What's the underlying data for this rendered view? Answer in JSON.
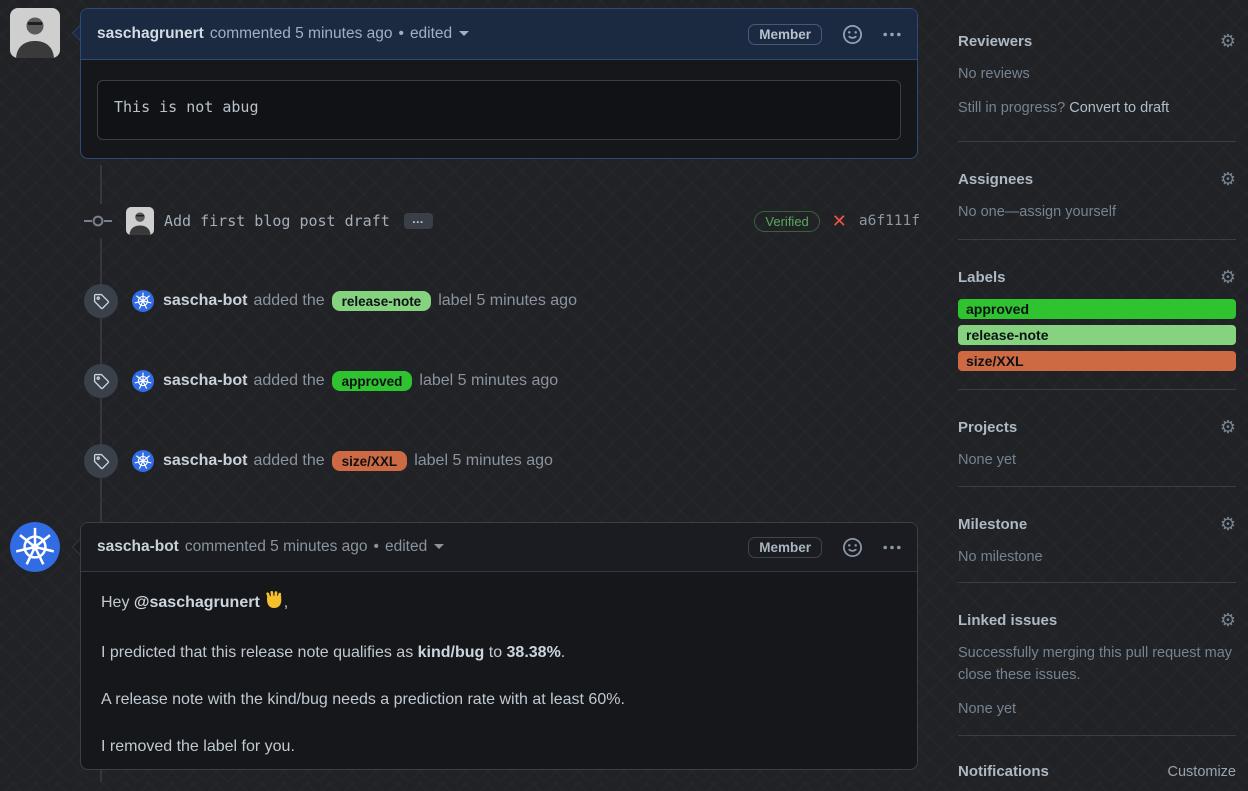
{
  "colors": {
    "highlight_border": "#2d4a75",
    "k8s_blue": "#326ce5",
    "verified_green": "#57ab5c",
    "error_red": "#ee5449",
    "label_approved": "#2fc42f",
    "label_release_note": "#85d37f",
    "label_size_xxl": "#cd6a44"
  },
  "icons": {
    "gear": "⚙",
    "x_mark": "✕"
  },
  "comment1": {
    "author": "saschagrunert",
    "action": "commented",
    "time": "5 minutes ago",
    "separator": "•",
    "edited_label": "edited",
    "member_badge": "Member",
    "code_text": "This is not abug"
  },
  "commit": {
    "message": "Add first blog post draft",
    "expand_label": "…",
    "verified_label": "Verified",
    "sha": "a6f111f"
  },
  "label_events": [
    {
      "actor": "sascha-bot",
      "action": "added the",
      "label": "release-note",
      "suffix": "label 5 minutes ago"
    },
    {
      "actor": "sascha-bot",
      "action": "added the",
      "label": "approved",
      "suffix": "label 5 minutes ago"
    },
    {
      "actor": "sascha-bot",
      "action": "added the",
      "label": "size/XXL",
      "suffix": "label 5 minutes ago"
    }
  ],
  "comment2": {
    "author": "sascha-bot",
    "action": "commented",
    "time": "5 minutes ago",
    "separator": "•",
    "edited_label": "edited",
    "member_badge": "Member",
    "greeting": {
      "prefix": "Hey ",
      "mention": "@saschagrunert",
      "emoji": "👋",
      "suffix": ","
    },
    "prediction": {
      "t1": "I predicted that this release note qualifies as ",
      "b1": "kind/bug",
      "t2": " to ",
      "b2": "38.38%",
      "t3": "."
    },
    "requirement": "A release note with the kind/bug needs a prediction rate with at least 60%.",
    "removal": "I removed the label for you."
  },
  "sidebar": {
    "reviewers": {
      "title": "Reviewers",
      "empty": "No reviews",
      "hint": "Still in progress?",
      "hint_link": "Convert to draft"
    },
    "assignees": {
      "title": "Assignees",
      "empty": "No one—",
      "empty_link": "assign yourself"
    },
    "labels": {
      "title": "Labels",
      "items": [
        "approved",
        "release-note",
        "size/XXL"
      ]
    },
    "projects": {
      "title": "Projects",
      "empty": "None yet"
    },
    "milestone": {
      "title": "Milestone",
      "empty": "No milestone"
    },
    "linked_issues": {
      "title": "Linked issues",
      "description": "Successfully merging this pull request may close these issues.",
      "empty": "None yet"
    },
    "notifications": {
      "title": "Notifications",
      "link": "Customize"
    }
  }
}
